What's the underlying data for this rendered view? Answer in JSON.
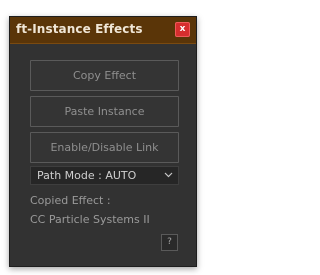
{
  "window": {
    "title": "ft-Instance Effects",
    "close_label": "x"
  },
  "buttons": {
    "copy_effect": "Copy Effect",
    "paste_instance": "Paste Instance",
    "enable_disable_link": "Enable/Disable Link"
  },
  "path_mode": {
    "selected": "Path Mode : AUTO"
  },
  "copied": {
    "label": "Copied Effect :",
    "value": "CC Particle Systems II"
  },
  "help": {
    "label": "?"
  },
  "icons": {
    "dropdown": "chevron-down-icon"
  },
  "colors": {
    "titlebar": "#5a3508",
    "panel": "#323232",
    "close": "#d62e2e"
  }
}
